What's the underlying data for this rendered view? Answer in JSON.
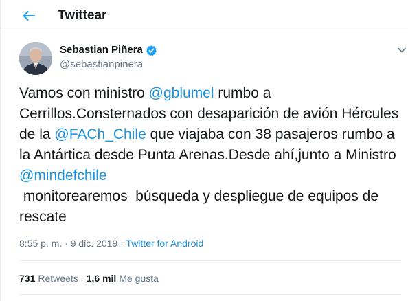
{
  "header": {
    "title": "Twittear"
  },
  "author": {
    "name": "Sebastian Piñera",
    "handle": "@sebastianpinera"
  },
  "tweet": {
    "segments": [
      {
        "text": "Vamos con ministro ",
        "mention": false
      },
      {
        "text": "@gblumel",
        "mention": true
      },
      {
        "text": " rumbo a Cerrillos.Consternados con desaparición de avión Hércules de la ",
        "mention": false
      },
      {
        "text": "@FACh_Chile",
        "mention": true
      },
      {
        "text": " que viajaba con 38 pasajeros rumbo a la Antártica desde Punta Arenas.Desde ahí,junto a Ministro ",
        "mention": false
      },
      {
        "text": "@mindefchile",
        "mention": true
      },
      {
        "text": "\n monitorearemos  búsqueda y despliegue de equipos de rescate",
        "mention": false
      }
    ]
  },
  "meta": {
    "time": "8:55 p. m.",
    "date": "9 dic. 2019",
    "separator1": " · ",
    "separator2": " · ",
    "source": "Twitter for Android"
  },
  "stats": {
    "retweets_count": "731",
    "retweets_label": "Retweets",
    "likes_count": "1,6 mil",
    "likes_label": "Me gusta"
  },
  "colors": {
    "accent": "#1b95e0",
    "text": "#14171a",
    "secondary": "#657786",
    "verified": "#1da1f2",
    "border": "#e6ecf0"
  },
  "icons": {
    "back": "arrow-left-icon",
    "verified": "verified-badge-icon",
    "caret": "chevron-down-icon"
  }
}
